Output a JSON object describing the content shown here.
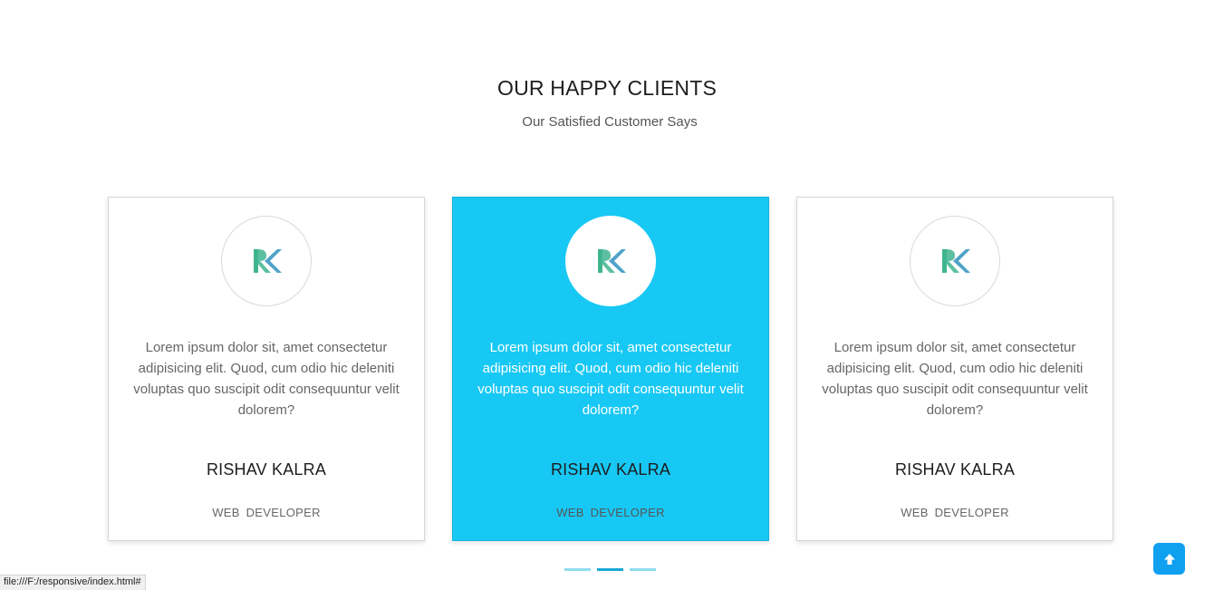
{
  "section": {
    "title": "OUR HAPPY CLIENTS",
    "subtitle": "Our Satisfied Customer Says"
  },
  "testimonials": [
    {
      "logo_icon": "rk-logo-icon",
      "quote": "Lorem ipsum dolor sit, amet consectetur adipisicing elit. Quod, cum odio hic deleniti voluptas quo suscipit odit consequuntur velit dolorem?",
      "name": "RISHAV KALRA",
      "role": "WEB  DEVELOPER",
      "active": false
    },
    {
      "logo_icon": "rk-logo-icon",
      "quote": "Lorem ipsum dolor sit, amet consectetur adipisicing elit. Quod, cum odio hic deleniti voluptas quo suscipit odit consequuntur velit dolorem?",
      "name": "RISHAV KALRA",
      "role": "WEB  DEVELOPER",
      "active": true
    },
    {
      "logo_icon": "rk-logo-icon",
      "quote": "Lorem ipsum dolor sit, amet consectetur adipisicing elit. Quod, cum odio hic deleniti voluptas quo suscipit odit consequuntur velit dolorem?",
      "name": "RISHAV KALRA",
      "role": "WEB  DEVELOPER",
      "active": false
    }
  ],
  "carousel": {
    "page_count": 3,
    "active_page": 2
  },
  "scroll_top": {
    "icon": "arrow-up-icon"
  },
  "status_bar": {
    "url": "file:///F:/responsive/index.html#"
  },
  "colors": {
    "accent": "#18c8f4",
    "pager_dot": "#8fdcf1",
    "pager_dot_active": "#18a9d8",
    "scroll_top_button": "#0fa0f0",
    "logo_green": "#3fb58f",
    "logo_blue": "#4fa3c9"
  }
}
